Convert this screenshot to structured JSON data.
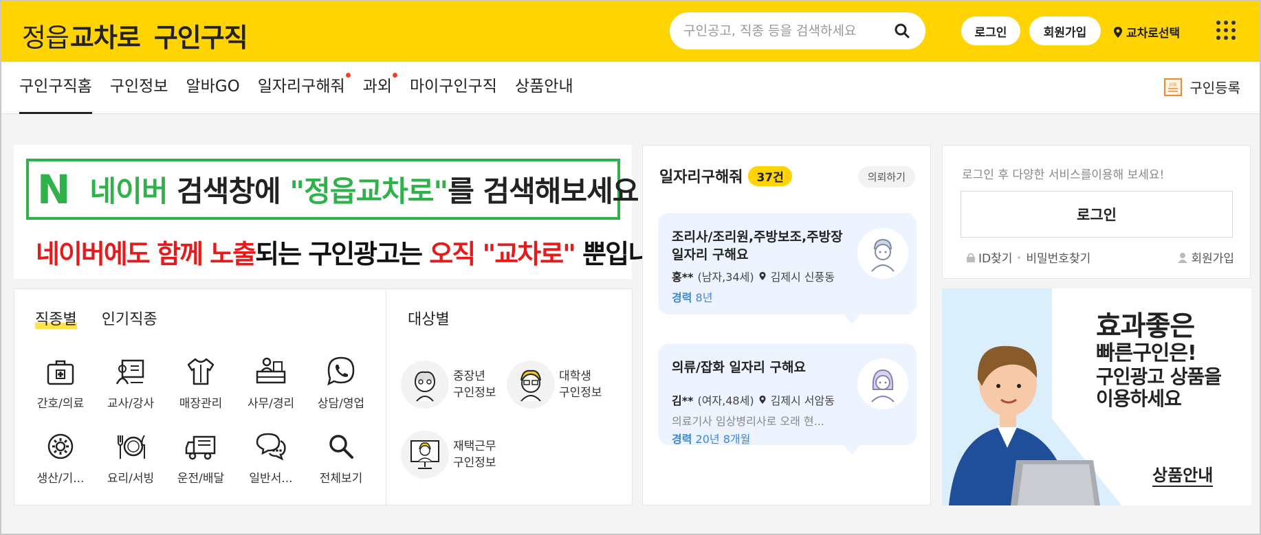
{
  "header": {
    "logo_part1": "정읍",
    "logo_part2": "교차로",
    "logo_part3": "구인구직",
    "search_placeholder": "구인공고, 직종 등을 검색하세요",
    "login_label": "로그인",
    "join_label": "회원가입",
    "region_label": "교차로선택",
    "brand_color": "#ffd400"
  },
  "nav": {
    "items": [
      {
        "label": "구인구직홈",
        "active": true,
        "dot": false
      },
      {
        "label": "구인정보",
        "active": false,
        "dot": false
      },
      {
        "label": "알바GO",
        "active": false,
        "dot": false
      },
      {
        "label": "일자리구해줘",
        "active": false,
        "dot": true
      },
      {
        "label": "과외",
        "active": false,
        "dot": true
      },
      {
        "label": "마이구인구직",
        "active": false,
        "dot": false
      },
      {
        "label": "상품안내",
        "active": false,
        "dot": false
      }
    ],
    "register_label": "구인등록"
  },
  "banner": {
    "logo": "N",
    "line1_a": "네이버",
    "line1_b": " 검색창에 ",
    "line1_c": "\"정읍교차로\"",
    "line1_d": "를 검색해보세요",
    "line2_a": "네이버에도 ",
    "line2_b": "함께",
    "line2_c": " 노출",
    "line2_d": "되는 구인광고는 ",
    "line2_e": "오직",
    "line2_f": " \"교차로\"",
    "line2_g": " 뿐입니다"
  },
  "categories": {
    "tab_job": "직종별",
    "tab_popular": "인기직종",
    "items": [
      {
        "label": "간호/의료",
        "icon": "medical-kit-icon"
      },
      {
        "label": "교사/강사",
        "icon": "teacher-board-icon"
      },
      {
        "label": "매장관리",
        "icon": "shirt-icon"
      },
      {
        "label": "사무/경리",
        "icon": "office-desk-icon"
      },
      {
        "label": "상담/영업",
        "icon": "phone-chat-icon"
      },
      {
        "label": "생산/기...",
        "icon": "gear-icon"
      },
      {
        "label": "요리/서빙",
        "icon": "fork-plate-icon"
      },
      {
        "label": "운전/배달",
        "icon": "truck-icon"
      },
      {
        "label": "일반서...",
        "icon": "chat-bubbles-icon"
      },
      {
        "label": "전체보기",
        "icon": "search-icon"
      }
    ],
    "target_title": "대상별",
    "targets": [
      {
        "line1": "중장년",
        "line2": "구인정보"
      },
      {
        "line1": "대학생",
        "line2": "구인정보"
      },
      {
        "line1": "재택근무",
        "line2": "구인정보"
      }
    ]
  },
  "seekers": {
    "title": "일자리구해줘",
    "count": "37건",
    "request_label": "의뢰하기",
    "posts": [
      {
        "title": "조리사/조리원,주방보조,주방장 일자리 구해요",
        "name": "홍**",
        "info": "(남자,34세)",
        "location": "김제시 신풍동",
        "exp_label": "경력",
        "exp_value": "8년",
        "desc": ""
      },
      {
        "title": "의류/잡화 일자리 구해요",
        "name": "김**",
        "info": "(여자,48세)",
        "location": "김제시 서암동",
        "exp_label": "경력",
        "exp_value": "20년 8개월",
        "desc": "의료기사 임상병리사로 오래 현..."
      }
    ]
  },
  "login_box": {
    "message": "로그인 후 다양한 서비스를이용해 보세요!",
    "button": "로그인",
    "find_id": "ID찾기",
    "find_pw": "비밀번호찾기",
    "join": "회원가입"
  },
  "ad": {
    "line1": "효과좋은",
    "line2": "빠른구인은!",
    "line3": "구인광고 상품을",
    "line4": "이용하세요",
    "more": "상품안내"
  }
}
